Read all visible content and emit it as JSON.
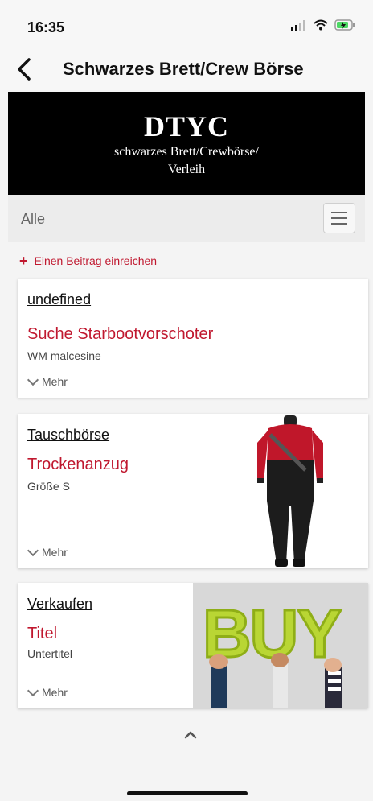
{
  "status": {
    "time": "16:35"
  },
  "nav": {
    "title": "Schwarzes Brett/Crew Börse"
  },
  "banner": {
    "heading": "DTYC",
    "line1": "schwarzes Brett/Crewbörse/",
    "line2": "Verleih"
  },
  "filter": {
    "label": "Alle"
  },
  "actions": {
    "submit_label": "Einen Beitrag einreichen"
  },
  "cards": [
    {
      "category": "undefined",
      "title": "Suche Starbootvorschoter",
      "subtitle": "WM malcesine",
      "more": "Mehr"
    },
    {
      "category": "Tauschbörse",
      "title": "Trockenanzug",
      "subtitle": "Größe S",
      "more": "Mehr"
    },
    {
      "category": "Verkaufen",
      "title": "Titel",
      "subtitle": "Untertitel",
      "more": "Mehr",
      "image_text": "BUY"
    }
  ],
  "colors": {
    "accent": "#c0182f",
    "banner_bg": "#000000"
  }
}
